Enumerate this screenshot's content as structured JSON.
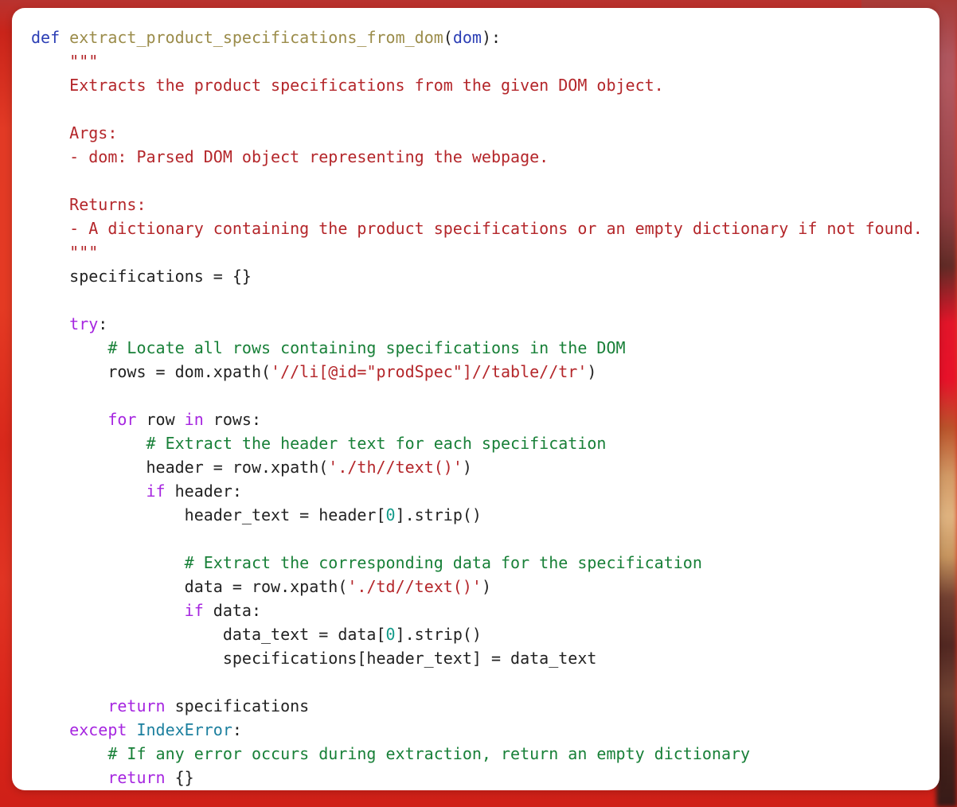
{
  "theme": {
    "background_red": "#d7281c",
    "card_background": "#ffffff",
    "keyword_color": "#a626e0",
    "def_color": "#2c3fb5",
    "function_name_color": "#9b8c4a",
    "builtin_color": "#1b7f9e",
    "string_color": "#b4262a",
    "comment_color": "#188038",
    "number_color": "#139b8a",
    "plain_text_color": "#222222"
  },
  "code": {
    "language": "python",
    "font_size_px": 20,
    "line_height_px": 30,
    "lines": [
      {
        "n": 1,
        "text": "def extract_product_specifications_from_dom(dom):"
      },
      {
        "n": 2,
        "text": "    \"\"\""
      },
      {
        "n": 3,
        "text": "    Extracts the product specifications from the given DOM object."
      },
      {
        "n": 4,
        "text": ""
      },
      {
        "n": 5,
        "text": "    Args:"
      },
      {
        "n": 6,
        "text": "    - dom: Parsed DOM object representing the webpage."
      },
      {
        "n": 7,
        "text": ""
      },
      {
        "n": 8,
        "text": "    Returns:"
      },
      {
        "n": 9,
        "text": "    - A dictionary containing the product specifications or an empty dictionary if not found."
      },
      {
        "n": 10,
        "text": "    \"\"\""
      },
      {
        "n": 11,
        "text": "    specifications = {}"
      },
      {
        "n": 12,
        "text": ""
      },
      {
        "n": 13,
        "text": "    try:"
      },
      {
        "n": 14,
        "text": "        # Locate all rows containing specifications in the DOM"
      },
      {
        "n": 15,
        "text": "        rows = dom.xpath('//li[@id=\"prodSpec\"]//table//tr')"
      },
      {
        "n": 16,
        "text": ""
      },
      {
        "n": 17,
        "text": "        for row in rows:"
      },
      {
        "n": 18,
        "text": "            # Extract the header text for each specification"
      },
      {
        "n": 19,
        "text": "            header = row.xpath('./th//text()')"
      },
      {
        "n": 20,
        "text": "            if header:"
      },
      {
        "n": 21,
        "text": "                header_text = header[0].strip()"
      },
      {
        "n": 22,
        "text": ""
      },
      {
        "n": 23,
        "text": "                # Extract the corresponding data for the specification"
      },
      {
        "n": 24,
        "text": "                data = row.xpath('./td//text()')"
      },
      {
        "n": 25,
        "text": "                if data:"
      },
      {
        "n": 26,
        "text": "                    data_text = data[0].strip()"
      },
      {
        "n": 27,
        "text": "                    specifications[header_text] = data_text"
      },
      {
        "n": 28,
        "text": ""
      },
      {
        "n": 29,
        "text": "        return specifications"
      },
      {
        "n": 30,
        "text": "    except IndexError:"
      },
      {
        "n": 31,
        "text": "        # If any error occurs during extraction, return an empty dictionary"
      },
      {
        "n": 32,
        "text": "        return {}"
      }
    ],
    "tokens": [
      [
        {
          "t": "def ",
          "c": "def"
        },
        {
          "t": "extract_product_specifications_from_dom",
          "c": "fname"
        },
        {
          "t": "(",
          "c": "plain"
        },
        {
          "t": "dom",
          "c": "param"
        },
        {
          "t": "):",
          "c": "plain"
        }
      ],
      [
        {
          "t": "    ",
          "c": "plain"
        },
        {
          "t": "\"\"\"",
          "c": "doc"
        }
      ],
      [
        {
          "t": "    Extracts the product specifications from the given DOM object.",
          "c": "doc"
        }
      ],
      [
        {
          "t": "",
          "c": "plain"
        }
      ],
      [
        {
          "t": "    Args:",
          "c": "doc"
        }
      ],
      [
        {
          "t": "    - dom: Parsed DOM object representing the webpage.",
          "c": "doc"
        }
      ],
      [
        {
          "t": "",
          "c": "plain"
        }
      ],
      [
        {
          "t": "    Returns:",
          "c": "doc"
        }
      ],
      [
        {
          "t": "    - A dictionary containing the product specifications or an empty dictionary if not found.",
          "c": "doc"
        }
      ],
      [
        {
          "t": "    ",
          "c": "plain"
        },
        {
          "t": "\"\"\"",
          "c": "doc"
        }
      ],
      [
        {
          "t": "    specifications = {}",
          "c": "plain"
        }
      ],
      [
        {
          "t": "",
          "c": "plain"
        }
      ],
      [
        {
          "t": "    ",
          "c": "plain"
        },
        {
          "t": "try",
          "c": "kw"
        },
        {
          "t": ":",
          "c": "plain"
        }
      ],
      [
        {
          "t": "        ",
          "c": "plain"
        },
        {
          "t": "# Locate all rows containing specifications in the DOM",
          "c": "comment"
        }
      ],
      [
        {
          "t": "        rows = dom.xpath(",
          "c": "plain"
        },
        {
          "t": "'//li[@id=\"prodSpec\"]//table//tr'",
          "c": "str"
        },
        {
          "t": ")",
          "c": "plain"
        }
      ],
      [
        {
          "t": "",
          "c": "plain"
        }
      ],
      [
        {
          "t": "        ",
          "c": "plain"
        },
        {
          "t": "for",
          "c": "kw"
        },
        {
          "t": " row ",
          "c": "plain"
        },
        {
          "t": "in",
          "c": "kw"
        },
        {
          "t": " rows:",
          "c": "plain"
        }
      ],
      [
        {
          "t": "            ",
          "c": "plain"
        },
        {
          "t": "# Extract the header text for each specification",
          "c": "comment"
        }
      ],
      [
        {
          "t": "            header = row.xpath(",
          "c": "plain"
        },
        {
          "t": "'./th//text()'",
          "c": "str"
        },
        {
          "t": ")",
          "c": "plain"
        }
      ],
      [
        {
          "t": "            ",
          "c": "plain"
        },
        {
          "t": "if",
          "c": "kw"
        },
        {
          "t": " header:",
          "c": "plain"
        }
      ],
      [
        {
          "t": "                header_text = header[",
          "c": "plain"
        },
        {
          "t": "0",
          "c": "num"
        },
        {
          "t": "].strip()",
          "c": "plain"
        }
      ],
      [
        {
          "t": "",
          "c": "plain"
        }
      ],
      [
        {
          "t": "                ",
          "c": "plain"
        },
        {
          "t": "# Extract the corresponding data for the specification",
          "c": "comment"
        }
      ],
      [
        {
          "t": "                data = row.xpath(",
          "c": "plain"
        },
        {
          "t": "'./td//text()'",
          "c": "str"
        },
        {
          "t": ")",
          "c": "plain"
        }
      ],
      [
        {
          "t": "                ",
          "c": "plain"
        },
        {
          "t": "if",
          "c": "kw"
        },
        {
          "t": " data:",
          "c": "plain"
        }
      ],
      [
        {
          "t": "                    data_text = data[",
          "c": "plain"
        },
        {
          "t": "0",
          "c": "num"
        },
        {
          "t": "].strip()",
          "c": "plain"
        }
      ],
      [
        {
          "t": "                    specifications[header_text] = data_text",
          "c": "plain"
        }
      ],
      [
        {
          "t": "",
          "c": "plain"
        }
      ],
      [
        {
          "t": "        ",
          "c": "plain"
        },
        {
          "t": "return",
          "c": "kw"
        },
        {
          "t": " specifications",
          "c": "plain"
        }
      ],
      [
        {
          "t": "    ",
          "c": "plain"
        },
        {
          "t": "except",
          "c": "kw"
        },
        {
          "t": " ",
          "c": "plain"
        },
        {
          "t": "IndexError",
          "c": "builtin"
        },
        {
          "t": ":",
          "c": "plain"
        }
      ],
      [
        {
          "t": "        ",
          "c": "plain"
        },
        {
          "t": "# If any error occurs during extraction, return an empty dictionary",
          "c": "comment"
        }
      ],
      [
        {
          "t": "        ",
          "c": "plain"
        },
        {
          "t": "return",
          "c": "kw"
        },
        {
          "t": " {}",
          "c": "plain"
        }
      ]
    ]
  }
}
